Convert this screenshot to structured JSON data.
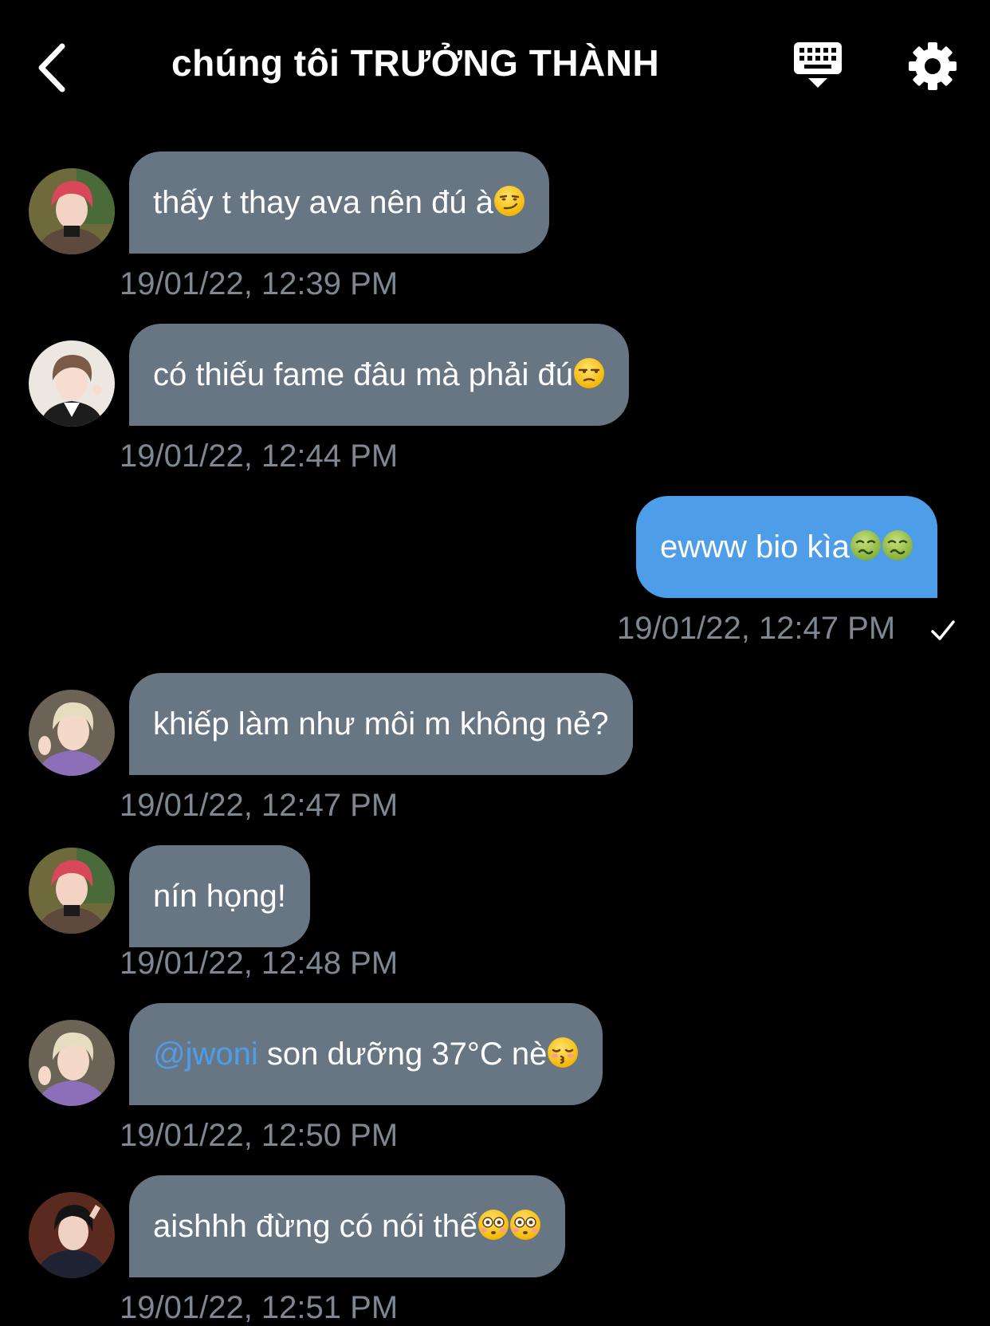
{
  "header": {
    "title": "chúng tôi TRƯỞNG THÀNH",
    "back_icon": "chevron-left-icon",
    "keyboard_icon": "keyboard-hide-icon",
    "settings_icon": "gear-icon"
  },
  "colors": {
    "background": "#000000",
    "incoming_bubble": "#687684",
    "outgoing_bubble": "#4d9de8",
    "timestamp": "#7d8893",
    "mention": "#4d9de8"
  },
  "messages": [
    {
      "direction": "incoming",
      "text": "thấy t thay ava nên đú à",
      "emoji": [
        "smirk"
      ],
      "time": "19/01/22, 12:39 PM",
      "avatar": "red-hair-avatar"
    },
    {
      "direction": "incoming",
      "text": "có thiếu fame đâu mà phải đú",
      "emoji": [
        "unamused"
      ],
      "time": "19/01/22, 12:44 PM",
      "avatar": "light-background-avatar"
    },
    {
      "direction": "outgoing",
      "text": "ewww bio kìa",
      "emoji": [
        "nauseated",
        "nauseated"
      ],
      "time": "19/01/22, 12:47 PM",
      "status_icon": "checkmark-icon"
    },
    {
      "direction": "incoming",
      "text": "khiếp làm như môi m không nẻ?",
      "emoji": [],
      "time": "19/01/22, 12:47 PM",
      "avatar": "blonde-hair-avatar"
    },
    {
      "direction": "incoming",
      "text": "nín họng!",
      "emoji": [],
      "time": "19/01/22, 12:48 PM",
      "avatar": "red-hair-avatar"
    },
    {
      "direction": "incoming",
      "mention": "@jwoni",
      "text": " son dưỡng 37°C nè",
      "emoji": [
        "kissing"
      ],
      "time": "19/01/22, 12:50 PM",
      "avatar": "blonde-hair-avatar"
    },
    {
      "direction": "incoming",
      "text": "aishhh đừng có nói thế",
      "emoji": [
        "flushed",
        "flushed"
      ],
      "time": "19/01/22, 12:51 PM",
      "avatar": "dark-hair-avatar"
    }
  ]
}
